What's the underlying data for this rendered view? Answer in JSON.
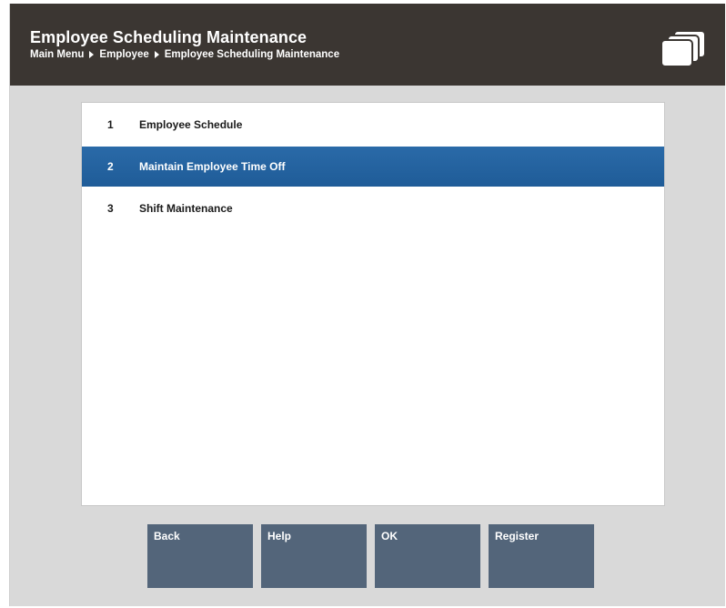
{
  "header": {
    "title": "Employee Scheduling Maintenance",
    "breadcrumb": [
      "Main Menu",
      "Employee",
      "Employee Scheduling Maintenance"
    ],
    "icon": "windows-stack-icon"
  },
  "menu": {
    "items": [
      {
        "number": "1",
        "label": "Employee Schedule",
        "selected": false
      },
      {
        "number": "2",
        "label": "Maintain Employee Time Off",
        "selected": true
      },
      {
        "number": "3",
        "label": "Shift Maintenance",
        "selected": false
      }
    ]
  },
  "buttons": {
    "back": "Back",
    "help": "Help",
    "ok": "OK",
    "register": "Register"
  },
  "colors": {
    "header_bg": "#3b3632",
    "selected_row": "#215f9b",
    "button_bg": "#53657a",
    "screen_bg": "#d9d9d9"
  }
}
